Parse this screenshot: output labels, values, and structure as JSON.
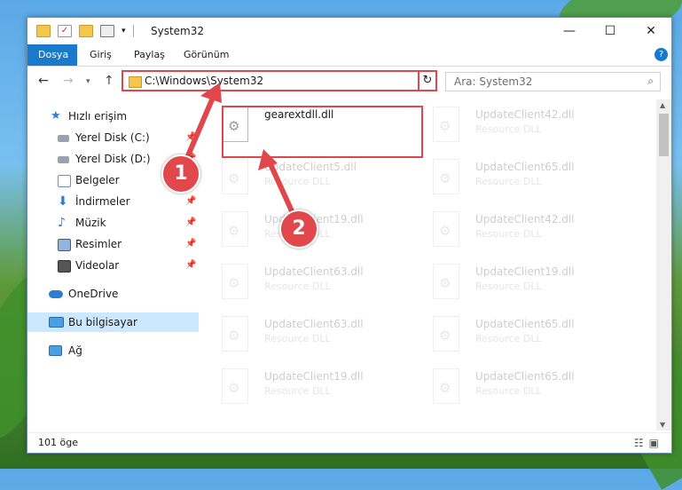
{
  "window": {
    "title": "System32"
  },
  "controls": {
    "minimize": "—",
    "maximize": "☐",
    "close": "✕"
  },
  "ribbon": {
    "tabs": [
      "Dosya",
      "Giriş",
      "Paylaş",
      "Görünüm"
    ],
    "help": "?"
  },
  "nav": {
    "address": "C:\\Windows\\System32",
    "search_placeholder": "Ara: System32"
  },
  "sidebar": {
    "items": [
      {
        "label": "Hızlı erişim",
        "icon": "star-icon",
        "pinned": false
      },
      {
        "label": "Yerel Disk (C:)",
        "icon": "drive-icon",
        "pinned": true
      },
      {
        "label": "Yerel Disk (D:)",
        "icon": "drive-icon",
        "pinned": true
      },
      {
        "label": "Belgeler",
        "icon": "documents-icon",
        "pinned": true
      },
      {
        "label": "İndirmeler",
        "icon": "download-icon",
        "pinned": true
      },
      {
        "label": "Müzik",
        "icon": "music-icon",
        "pinned": true
      },
      {
        "label": "Resimler",
        "icon": "pictures-icon",
        "pinned": true
      },
      {
        "label": "Videolar",
        "icon": "video-icon",
        "pinned": true
      },
      {
        "label": "OneDrive",
        "icon": "cloud-icon",
        "pinned": false
      },
      {
        "label": "Bu bilgisayar",
        "icon": "computer-icon",
        "pinned": false,
        "selected": true
      },
      {
        "label": "Ağ",
        "icon": "network-icon",
        "pinned": false
      }
    ]
  },
  "files": [
    {
      "name": "gearextdll.dll",
      "type": "",
      "highlighted": true
    },
    {
      "name": "UpdateClient42.dll",
      "type": "Resource DLL"
    },
    {
      "name": "UpdateClient5.dll",
      "type": "Resource DLL"
    },
    {
      "name": "UpdateClient65.dll",
      "type": "Resource DLL"
    },
    {
      "name": "UpdateClient19.dll",
      "type": "Resource DLL"
    },
    {
      "name": "UpdateClient42.dll",
      "type": "Resource DLL"
    },
    {
      "name": "UpdateClient63.dll",
      "type": "Resource DLL"
    },
    {
      "name": "UpdateClient19.dll",
      "type": "Resource DLL"
    },
    {
      "name": "UpdateClient63.dll",
      "type": "Resource DLL"
    },
    {
      "name": "UpdateClient65.dll",
      "type": "Resource DLL"
    },
    {
      "name": "UpdateClient19.dll",
      "type": "Resource DLL"
    },
    {
      "name": "UpdateClient65.dll",
      "type": "Resource DLL"
    }
  ],
  "status": {
    "count": "101 öge"
  },
  "callouts": [
    "1",
    "2"
  ],
  "colors": {
    "accent": "#1979ca",
    "annotation": "#e0474c"
  }
}
